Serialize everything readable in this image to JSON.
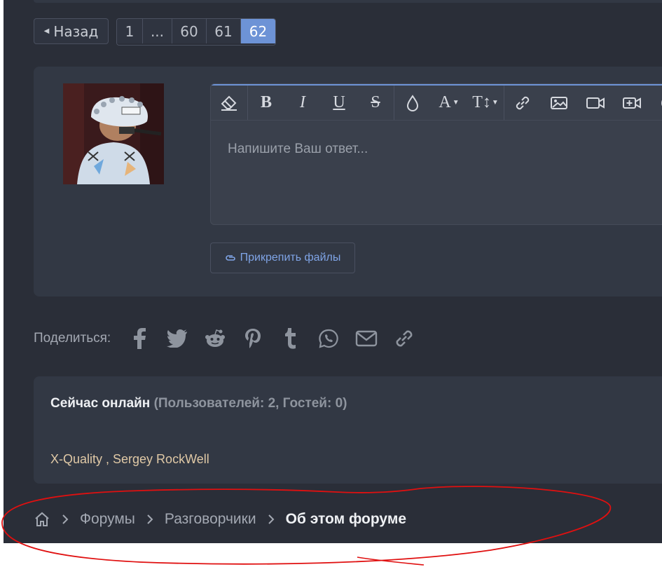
{
  "pagination": {
    "prev_label": "Назад",
    "pages": [
      "1",
      "...",
      "60",
      "61",
      "62"
    ],
    "current": "62"
  },
  "editor": {
    "placeholder": "Напишите Ваш ответ...",
    "toolbar_icons": [
      "eraser-icon",
      "bold-icon",
      "italic-icon",
      "underline-icon",
      "strikethrough-icon",
      "color-drop-icon",
      "font-family-icon",
      "font-size-icon",
      "link-icon",
      "image-icon",
      "video-icon",
      "media-embed-icon"
    ]
  },
  "attach": {
    "label": "Прикрепить файлы"
  },
  "share": {
    "label": "Поделиться:",
    "networks": [
      "facebook",
      "twitter",
      "reddit",
      "pinterest",
      "tumblr",
      "whatsapp",
      "email",
      "link"
    ]
  },
  "online": {
    "title": "Сейчас онлайн",
    "stats": "(Пользователей: 2, Гостей: 0)",
    "users": "X-Quality , Sergey RockWell"
  },
  "breadcrumb": {
    "items": [
      "Форумы",
      "Разговорчики"
    ],
    "current": "Об этом форуме"
  },
  "colors": {
    "background": "#2a2e38",
    "panel": "#323844",
    "accent": "#6d93d6",
    "annotation": "#e01010"
  }
}
